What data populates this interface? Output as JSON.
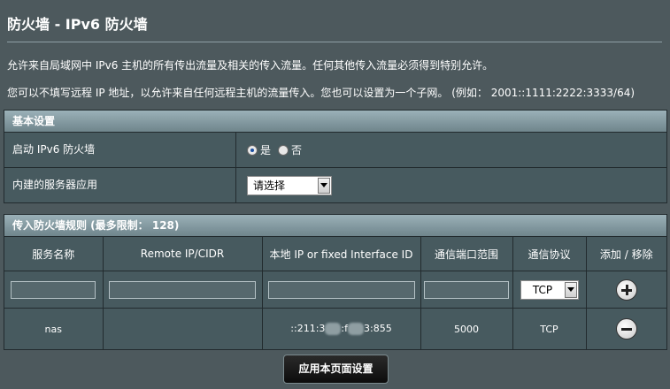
{
  "page": {
    "title": "防火墙 - IPv6 防火墙",
    "description_1": "允许来自局域网中 IPv6 主机的所有传出流量及相关的传入流量。任何其他传入流量必须得到特别允许。",
    "description_2": "您可以不填写远程 IP 地址，以允许来自任何远程主机的流量传入。您也可以设置为一个子网。 (例如： 2001::1111:2222:3333/64)"
  },
  "basic": {
    "header": "基本设置",
    "enable_label": "启动 IPv6 防火墙",
    "yes_label": "是",
    "no_label": "否",
    "selected": "yes",
    "builtin_label": "内建的服务器应用",
    "builtin_value": "请选择"
  },
  "rules": {
    "header": "传入防火墙规则 (最多限制： 128)",
    "columns": [
      "服务名称",
      "Remote IP/CIDR",
      "本地 IP or fixed Interface ID",
      "通信端口范围",
      "通信协议",
      "添加 / 移除"
    ],
    "protocol_default": "TCP",
    "entries": [
      {
        "name": "nas",
        "remote": "",
        "local_a": "::211:3",
        "local_b": ":f",
        "local_c": "3:855",
        "port": "5000",
        "protocol": "TCP"
      }
    ]
  },
  "apply_label": "应用本页面设置"
}
